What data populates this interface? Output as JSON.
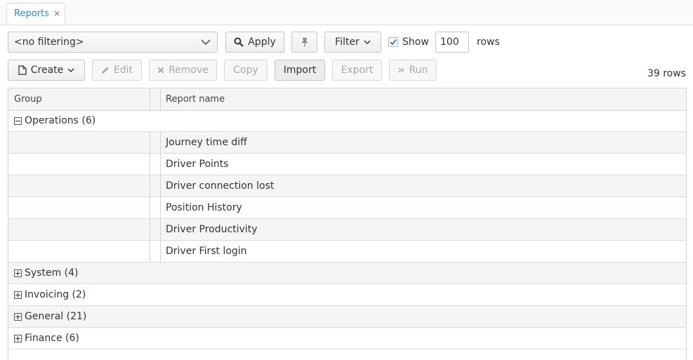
{
  "tab": {
    "label": "Reports",
    "close": "×"
  },
  "toolbar": {
    "filter_select": "<no filtering>",
    "apply": "Apply",
    "filter": "Filter",
    "show": "Show",
    "rows_value": "100",
    "rows": "rows"
  },
  "actions": {
    "create": "Create",
    "edit": "Edit",
    "remove": "Remove",
    "copy": "Copy",
    "import": "Import",
    "export": "Export",
    "run": "Run"
  },
  "row_count": "39 rows",
  "table": {
    "headers": [
      "Group",
      "Report name"
    ],
    "groups": [
      {
        "label": "Operations (6)",
        "expanded": true,
        "reports": [
          "Journey time diff",
          "Driver Points",
          "Driver connection lost",
          "Position History",
          "Driver Productivity",
          "Driver First login"
        ]
      },
      {
        "label": "System (4)",
        "expanded": false
      },
      {
        "label": "Invoicing (2)",
        "expanded": false
      },
      {
        "label": "General (21)",
        "expanded": false
      },
      {
        "label": "Finance (6)",
        "expanded": false
      }
    ]
  },
  "colors": {
    "accent": "#3b83c0",
    "checkbox": "#3b83c0"
  }
}
